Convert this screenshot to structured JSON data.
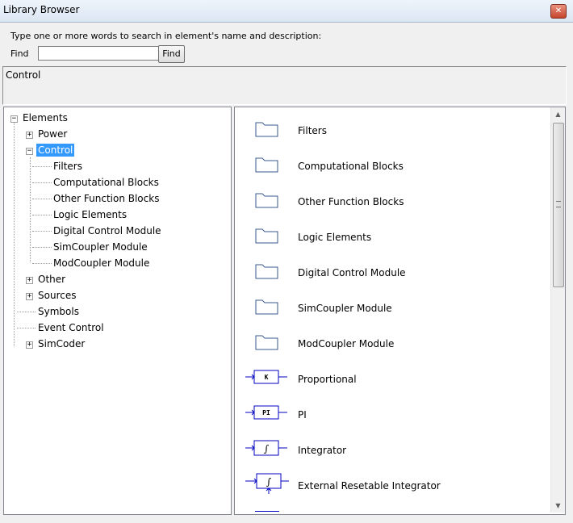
{
  "window": {
    "title": "Library Browser",
    "close_icon": "close-icon"
  },
  "search": {
    "hint": "Type one or more words to search in element's name and  description:",
    "find_label": "Find",
    "input_value": "",
    "find_button": "Find"
  },
  "description": {
    "text": "Control"
  },
  "tree": {
    "root": "Elements",
    "nodes": [
      {
        "label": "Power"
      },
      {
        "label": "Control"
      },
      {
        "label": "Filters"
      },
      {
        "label": "Computational Blocks"
      },
      {
        "label": "Other Function Blocks"
      },
      {
        "label": "Logic Elements"
      },
      {
        "label": "Digital Control Module"
      },
      {
        "label": "SimCoupler Module"
      },
      {
        "label": "ModCoupler Module"
      },
      {
        "label": "Other"
      },
      {
        "label": "Sources"
      },
      {
        "label": "Symbols"
      },
      {
        "label": "Event Control"
      },
      {
        "label": "SimCoder"
      }
    ]
  },
  "list": {
    "items": [
      {
        "label": "Filters",
        "icon": "folder-icon"
      },
      {
        "label": "Computational Blocks",
        "icon": "folder-icon"
      },
      {
        "label": "Other Function Blocks",
        "icon": "folder-icon"
      },
      {
        "label": "Logic Elements",
        "icon": "folder-icon"
      },
      {
        "label": "Digital Control Module",
        "icon": "folder-icon"
      },
      {
        "label": "SimCoupler Module",
        "icon": "folder-icon"
      },
      {
        "label": "ModCoupler Module",
        "icon": "folder-icon"
      },
      {
        "label": "Proportional",
        "icon": "proportional-block-icon",
        "block_text": "K"
      },
      {
        "label": "PI",
        "icon": "pi-block-icon",
        "block_text": "PI"
      },
      {
        "label": "Integrator",
        "icon": "integrator-block-icon",
        "block_text": "∫"
      },
      {
        "label": "External Resetable Integrator",
        "icon": "resetable-integrator-icon",
        "block_text": "∫"
      }
    ]
  },
  "colors": {
    "selection": "#3399ff",
    "block_wire": "#0000c0"
  }
}
